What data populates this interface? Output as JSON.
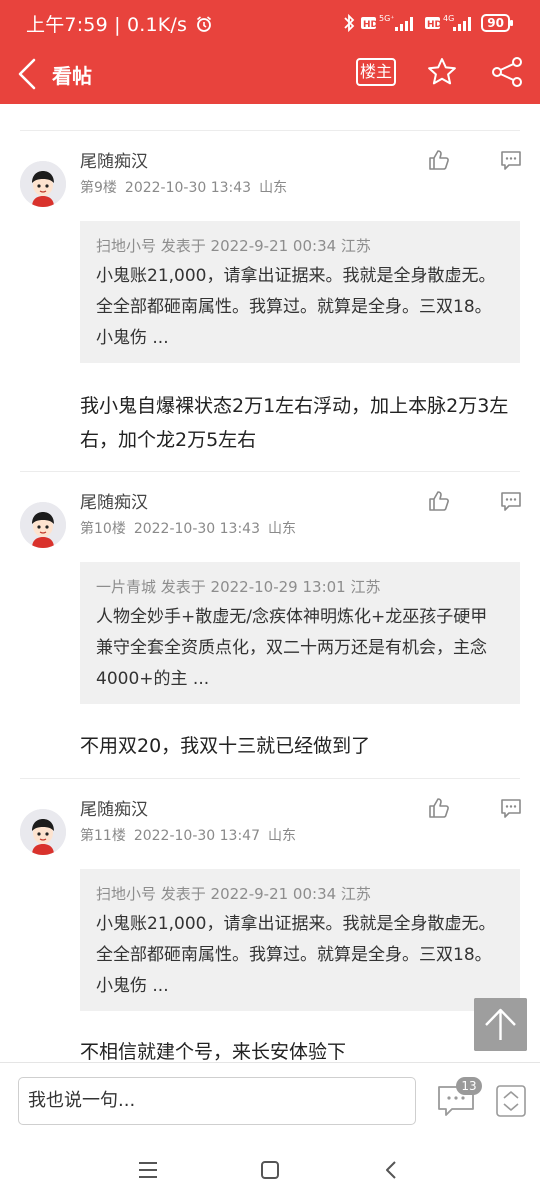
{
  "status_bar": {
    "time_speed": "上午7:59 | 0.1K/s",
    "battery": "90",
    "network_1": "5G⁺",
    "network_2": "4G"
  },
  "nav": {
    "title": "看帖",
    "louzhu_label": "楼主"
  },
  "theme": {
    "accent": "#e8433d",
    "quote_bg": "#f0f0f0",
    "meta_color": "#8a8a8a"
  },
  "posts": [
    {
      "author": "尾随痴汉",
      "floor": "第9楼",
      "time": "2022-10-30 13:43",
      "region": "山东",
      "quote_head": "扫地小号 发表于 2022-9-21 00:34 江苏",
      "quote_body": "小鬼账21,000，请拿出证据来。我就是全身散虚无。全全部都砸南属性。我算过。就算是全身。三双18。小鬼伤 ...",
      "body": "我小鬼自爆裸状态2万1左右浮动，加上本脉2万3左右，加个龙2万5左右"
    },
    {
      "author": "尾随痴汉",
      "floor": "第10楼",
      "time": "2022-10-30 13:43",
      "region": "山东",
      "quote_head": "一片青城 发表于 2022-10-29 13:01 江苏",
      "quote_body": "人物全妙手+散虚无/念疾体神明炼化+龙巫孩子硬甲兼守全套全资质点化，双二十两万还是有机会，主念4000+的主 ...",
      "body": "不用双20，我双十三就已经做到了"
    },
    {
      "author": "尾随痴汉",
      "floor": "第11楼",
      "time": "2022-10-30 13:47",
      "region": "山东",
      "quote_head": "扫地小号 发表于 2022-9-21 00:34 江苏",
      "quote_body": "小鬼账21,000，请拿出证据来。我就是全身散虚无。全全部都砸南属性。我算过。就算是全身。三双18。小鬼伤 ...",
      "body": "不相信就建个号，来长安体验下"
    }
  ],
  "bottom_bar": {
    "input_placeholder": "我也说一句...",
    "comment_count": "13"
  }
}
